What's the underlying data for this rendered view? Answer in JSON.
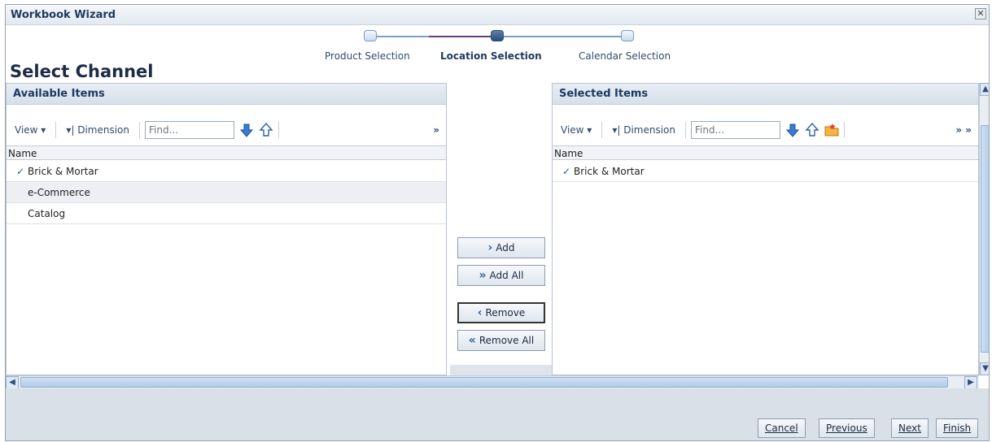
{
  "window": {
    "title": "Workbook Wizard",
    "close_glyph": "✕"
  },
  "train": {
    "steps": [
      {
        "label": "Product Selection",
        "active": false
      },
      {
        "label": "Location Selection",
        "active": true
      },
      {
        "label": "Calendar Selection",
        "active": false
      }
    ]
  },
  "page_title": "Select Channel",
  "available": {
    "header": "Available Items",
    "toolbar": {
      "view_label": "View ▾",
      "dimension_label": "▾| Dimension",
      "find_placeholder": "Find...",
      "more": "»"
    },
    "column_header": "Name",
    "items": [
      {
        "label": "Brick & Mortar",
        "checked": true
      },
      {
        "label": "e-Commerce",
        "checked": false
      },
      {
        "label": "Catalog",
        "checked": false
      }
    ]
  },
  "selected": {
    "header": "Selected Items",
    "toolbar": {
      "view_label": "View ▾",
      "dimension_label": "▾| Dimension",
      "find_placeholder": "Find...",
      "more": "» »"
    },
    "column_header": "Name",
    "items": [
      {
        "label": "Brick & Mortar",
        "checked": true
      }
    ]
  },
  "shuttle": {
    "add": "Add",
    "add_all": "Add All",
    "remove": "Remove",
    "remove_all": "Remove All"
  },
  "footer": {
    "cancel": "Cancel",
    "previous": "Previous",
    "next": "Next",
    "finish": "Finish"
  },
  "colors": {
    "accent": "#1c3a5e",
    "panel_header_bg": "#d6dfea",
    "footer_bg": "#d9e0e8"
  }
}
